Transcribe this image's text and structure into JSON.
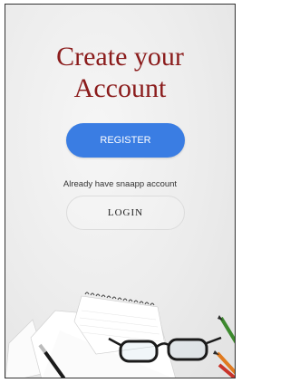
{
  "screen": {
    "title_line1": "Create your",
    "title_line2": "Account",
    "register_label": "REGISTER",
    "already_text": "Already have snaapp account",
    "login_label": "LOGIN"
  },
  "colors": {
    "title": "#8b1c1c",
    "register_bg": "#3a7de3",
    "background": "#ececec"
  },
  "illustration": {
    "items": [
      "spiral-notepad",
      "eyeglasses",
      "pencils",
      "pen"
    ]
  }
}
